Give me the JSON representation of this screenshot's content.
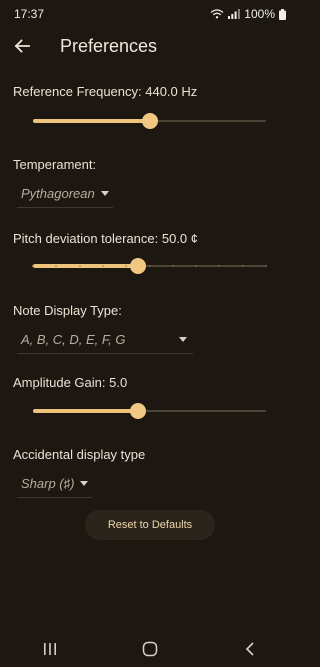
{
  "status": {
    "time": "17:37",
    "battery": "100%"
  },
  "app_bar": {
    "title": "Preferences"
  },
  "reference_frequency": {
    "label": "Reference Frequency: 440.0 Hz",
    "fraction": 0.5
  },
  "temperament": {
    "label": "Temperament:",
    "value": "Pythagorean"
  },
  "pitch_tolerance": {
    "label": "Pitch deviation tolerance: 50.0 ¢",
    "fraction": 0.45,
    "ticks": 10
  },
  "note_display": {
    "label": "Note Display Type:",
    "value": "A, B, C, D, E, F, G"
  },
  "amplitude_gain": {
    "label": "Amplitude Gain: 5.0",
    "fraction": 0.45
  },
  "accidental": {
    "label": "Accidental display type",
    "value": "Sharp (♯)"
  },
  "reset": {
    "label": "Reset to Defaults"
  },
  "colors": {
    "accent": "#eec47c",
    "background": "#1c1811",
    "track": "#4c4536"
  },
  "icons": {
    "back": "arrow-left-icon",
    "recents": "recents-icon",
    "home": "home-icon",
    "nav_back": "chevron-left-icon"
  }
}
